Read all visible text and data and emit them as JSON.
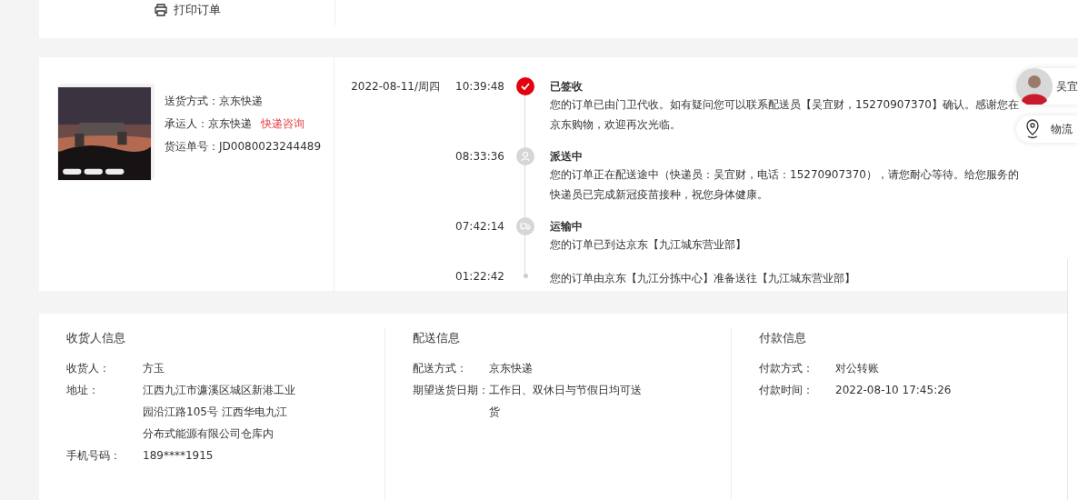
{
  "top": {
    "print_label": "打印订单"
  },
  "shipment": {
    "fields": [
      {
        "label": "送货方式：",
        "value": "京东快递"
      },
      {
        "label": "承运人：",
        "value": "京东快递",
        "link": "快递咨询"
      },
      {
        "label": "货运单号：",
        "value": "JD0080023244489"
      }
    ]
  },
  "timeline": [
    {
      "date": "2022-08-11/周四",
      "time": "10:39:48",
      "kind": "signed",
      "title": "已签收",
      "text": "您的订单已由门卫代收。如有疑问您可以联系配送员【吴宜财，15270907370】确认。感谢您在京东购物，欢迎再次光临。"
    },
    {
      "time": "08:33:36",
      "kind": "delivering",
      "title": "派送中",
      "text": "您的订单正在配送途中（快递员：吴宜财，电话：15270907370），请您耐心等待。给您服务的快递员已完成新冠疫苗接种，祝您身体健康。"
    },
    {
      "time": "07:42:14",
      "kind": "transit",
      "title": "运输中",
      "text": "您的订单已到达京东【九江城东营业部】"
    },
    {
      "time": "01:22:42",
      "kind": "dot",
      "text": "您的订单由京东【九江分拣中心】准备送往【九江城东营业部】"
    }
  ],
  "courier": {
    "name": "吴宜"
  },
  "logistics": {
    "label": "物流"
  },
  "info_sections": [
    {
      "title": "收货人信息",
      "rows": [
        {
          "label": "收货人：",
          "value": "方玉"
        },
        {
          "label": "地址：",
          "value": "江西九江市濂溪区城区新港工业园沿江路105号 江西华电九江分布式能源有限公司仓库内"
        },
        {
          "label": "手机号码：",
          "value": "189****1915"
        }
      ]
    },
    {
      "title": "配送信息",
      "rows": [
        {
          "label": "配送方式：",
          "value": "京东快递"
        },
        {
          "label": "期望送货日期：",
          "value": "工作日、双休日与节假日均可送货"
        }
      ]
    },
    {
      "title": "付款信息",
      "rows": [
        {
          "label": "付款方式：",
          "value": "对公转账"
        },
        {
          "label": "付款时间：",
          "value": "2022-08-10 17:45:26"
        }
      ]
    }
  ]
}
